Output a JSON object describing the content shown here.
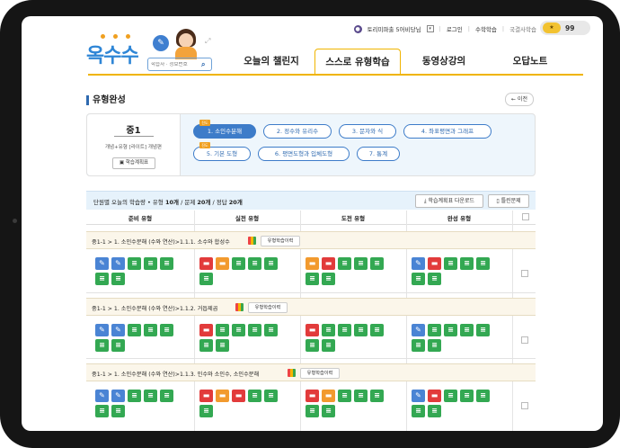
{
  "utility": {
    "user": "토리미파출 5어비당님",
    "login": "로그인",
    "math": "수학학습",
    "national": "국결사학습",
    "points": "99"
  },
  "logo": {
    "text": "옥수수"
  },
  "search": {
    "placeholder": "학습자 · 정보번호"
  },
  "nav": {
    "items": [
      "오늘의 챌린지",
      "스스로 유형학습",
      "동영상강의",
      "오답노트"
    ],
    "active_index": 1
  },
  "section": {
    "title": "유형완성",
    "prev_label": "← 이전"
  },
  "level": {
    "grade": "중1",
    "desc": "개념+유형 [라이트] 개념편",
    "plan_button": "학습계획표",
    "tag_label": "진도",
    "chips": [
      "1. 소인수분해",
      "2. 정수와 유리수",
      "3. 문자와 식",
      "4. 좌표평면과 그래프",
      "5. 기본 도형",
      "6. 평면도형과 입체도형",
      "7. 통계"
    ]
  },
  "table": {
    "summary_prefix": "단원별 오늘의 학습량 • 유형",
    "summary_types": "10개",
    "summary_mid": "/ 문제",
    "summary_problems": "20개",
    "summary_mid2": "/ 정답",
    "summary_answers": "20개",
    "download_button": "학습계획표 다운로드",
    "wrong_button": "틀린문제",
    "columns": [
      "준비 유형",
      "실전 유형",
      "도전 유형",
      "완성 유형"
    ],
    "history_button": "유형학습이력",
    "groups": [
      {
        "title": "중1-1 > 1. 소인수분해 (수와 연산)>1.1.1. 소수와 합성수"
      },
      {
        "title": "중1-1 > 1. 소인수분해 (수와 연산)>1.1.2. 거듭제곱"
      },
      {
        "title": "중1-1 > 1. 소인수분해 (수와 연산)>1.1.3. 인수와 소인수, 소인수분해"
      }
    ]
  },
  "colors": {
    "accent_blue": "#3d7cc9",
    "nav_gold": "#f0b400",
    "icon_blue": "#4a84d4",
    "icon_green": "#33a852",
    "icon_red": "#e23b3b",
    "icon_orange": "#f29a2e"
  }
}
